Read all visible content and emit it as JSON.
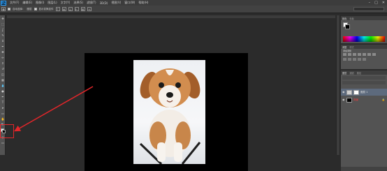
{
  "app": {
    "logo": "Ps"
  },
  "menu": [
    "文件(F)",
    "编辑(E)",
    "图像(I)",
    "图层(L)",
    "文字(Y)",
    "选择(S)",
    "滤镜(T)",
    "3D(D)",
    "视图(V)",
    "窗口(W)",
    "帮助(H)"
  ],
  "window_controls": {
    "minimize": "–",
    "maximize": "□",
    "close": "✕"
  },
  "options_bar": {
    "auto_select_label": "自动选择：",
    "auto_select_value": "图层",
    "transform_label": "显示变换控件"
  },
  "toolbar": {
    "tools": [
      "move-tool",
      "marquee-tool",
      "lasso-tool",
      "quick-select-tool",
      "crop-tool",
      "eyedropper-tool",
      "healing-tool",
      "brush-tool",
      "stamp-tool",
      "history-brush-tool",
      "eraser-tool",
      "gradient-tool",
      "blur-tool",
      "dodge-tool",
      "pen-tool",
      "type-tool",
      "path-select-tool",
      "shape-tool",
      "hand-tool",
      "zoom-tool"
    ],
    "glyphs": [
      "✥",
      "⬚",
      "ʆ",
      "✎",
      "⌗",
      "✒",
      "✚",
      "✏",
      "⚲",
      "↺",
      "◫",
      "▦",
      "💧",
      "●",
      "✒",
      "T",
      "➤",
      "▭",
      "✋",
      "🔍"
    ],
    "foreground_color": "#ffffff",
    "background_color": "#000000"
  },
  "color_panel": {
    "tabs": [
      "颜色",
      "色板"
    ]
  },
  "adjustments_panel": {
    "tabs": [
      "调整",
      "样式"
    ],
    "subtitle": "添加调整"
  },
  "layers_panel": {
    "tabs": [
      "图层",
      "通道",
      "路径"
    ],
    "layers": [
      {
        "name": "图层 1",
        "thumb": "photo",
        "has_mask": true,
        "selected": true
      },
      {
        "name": "背景",
        "thumb": "black",
        "has_mask": false,
        "selected": false,
        "locked": true
      }
    ]
  },
  "annotations": {
    "color": "#e3262a"
  }
}
